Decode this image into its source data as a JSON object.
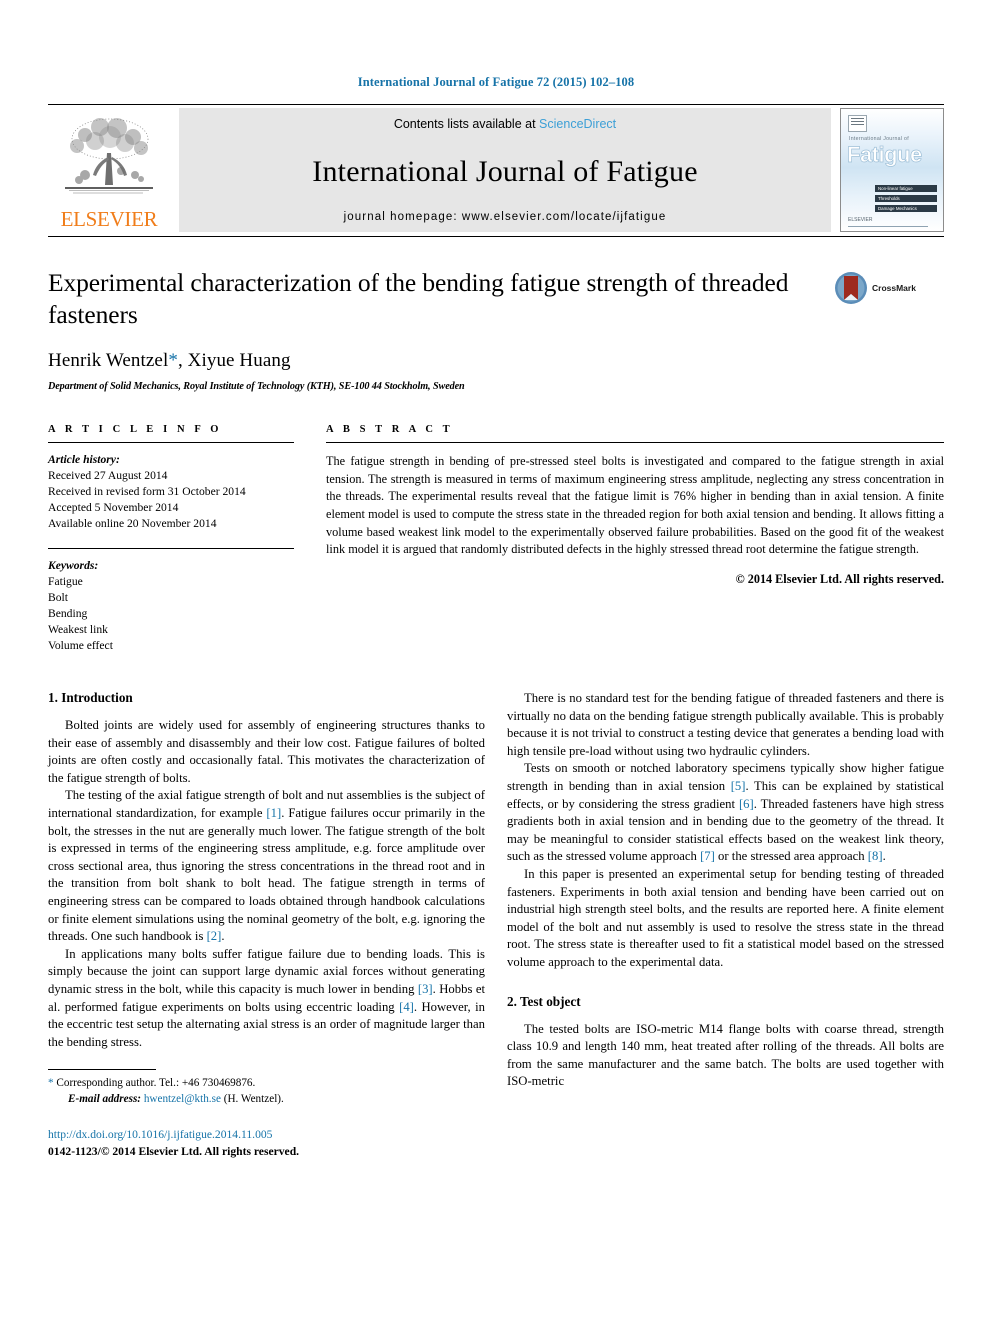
{
  "running_head": "International Journal of Fatigue 72 (2015) 102–108",
  "masthead": {
    "publisher_name": "ELSEVIER",
    "contents_prefix": "Contents lists available at",
    "contents_link": "ScienceDirect",
    "journal_title": "International Journal of Fatigue",
    "homepage": "journal homepage: www.elsevier.com/locate/ijfatigue",
    "cover": {
      "small_title": "International Journal of",
      "big_title": "Fatigue",
      "bars": [
        "Non-linear fatigue",
        "Thresholds",
        "Damage Mechanics"
      ],
      "footer": "ELSEVIER"
    }
  },
  "article": {
    "title": "Experimental characterization of the bending fatigue strength of threaded fasteners",
    "authors": "Henrik Wentzel",
    "author_star": "*",
    "authors_rest": ", Xiyue Huang",
    "affiliation": "Department of Solid Mechanics, Royal Institute of Technology (KTH), SE-100 44 Stockholm, Sweden",
    "crossmark_label": "CrossMark"
  },
  "info": {
    "heading": "A R T I C L E   I N F O",
    "history_label": "Article history:",
    "history": [
      "Received 27 August 2014",
      "Received in revised form 31 October 2014",
      "Accepted 5 November 2014",
      "Available online 20 November 2014"
    ],
    "keywords_label": "Keywords:",
    "keywords": [
      "Fatigue",
      "Bolt",
      "Bending",
      "Weakest link",
      "Volume effect"
    ]
  },
  "abstract": {
    "heading": "A B S T R A C T",
    "text": "The fatigue strength in bending of pre-stressed steel bolts is investigated and compared to the fatigue strength in axial tension. The strength is measured in terms of maximum engineering stress amplitude, neglecting any stress concentration in the threads. The experimental results reveal that the fatigue limit is 76% higher in bending than in axial tension. A finite element model is used to compute the stress state in the threaded region for both axial tension and bending. It allows fitting a volume based weakest link model to the experimentally observed failure probabilities. Based on the good fit of the weakest link model it is argued that randomly distributed defects in the highly stressed thread root determine the fatigue strength.",
    "copyright": "© 2014 Elsevier Ltd. All rights reserved."
  },
  "sections": {
    "intro_heading": "1. Introduction",
    "intro_p1": "Bolted joints are widely used for assembly of engineering structures thanks to their ease of assembly and disassembly and their low cost. Fatigue failures of bolted joints are often costly and occasionally fatal. This motivates the characterization of the fatigue strength of bolts.",
    "intro_p2_a": "The testing of the axial fatigue strength of bolt and nut assemblies is the subject of international standardization, for example ",
    "intro_p2_c1": "[1]",
    "intro_p2_b": ". Fatigue failures occur primarily in the bolt, the stresses in the nut are generally much lower. The fatigue strength of the bolt is expressed in terms of the engineering stress amplitude, e.g. force amplitude over cross sectional area, thus ignoring the stress concentrations in the thread root and in the transition from bolt shank to bolt head. The fatigue strength in terms of engineering stress can be compared to loads obtained through handbook calculations or finite element simulations using the nominal geometry of the bolt, e.g. ignoring the threads. One such handbook is ",
    "intro_p2_c2": "[2]",
    "intro_p2_end": ".",
    "intro_p3_a": "In applications many bolts suffer fatigue failure due to bending loads. This is simply because the joint can support large dynamic axial forces without generating dynamic stress in the bolt, while this capacity is much lower in bending ",
    "intro_p3_c1": "[3]",
    "intro_p3_b": ". Hobbs et al. performed fatigue experiments on bolts using eccentric loading ",
    "intro_p3_c2": "[4]",
    "intro_p3_end": ". However, in the eccentric test setup the alternating axial stress is an order of magnitude larger than the bending stress.",
    "right_p1": "There is no standard test for the bending fatigue of threaded fasteners and there is virtually no data on the bending fatigue strength publically available. This is probably because it is not trivial to construct a testing device that generates a bending load with high tensile pre-load without using two hydraulic cylinders.",
    "right_p2_a": "Tests on smooth or notched laboratory specimens typically show higher fatigue strength in bending than in axial tension ",
    "right_p2_c1": "[5]",
    "right_p2_b": ". This can be explained by statistical effects, or by considering the stress gradient ",
    "right_p2_c2": "[6]",
    "right_p2_c": ". Threaded fasteners have high stress gradients both in axial tension and in bending due to the geometry of the thread. It may be meaningful to consider statistical effects based on the weakest link theory, such as the stressed volume approach ",
    "right_p2_c3": "[7]",
    "right_p2_d": " or the stressed area approach ",
    "right_p2_c4": "[8]",
    "right_p2_end": ".",
    "right_p3": "In this paper is presented an experimental setup for bending testing of threaded fasteners. Experiments in both axial tension and bending have been carried out on industrial high strength steel bolts, and the results are reported here. A finite element model of the bolt and nut assembly is used to resolve the stress state in the thread root. The stress state is thereafter used to fit a statistical model based on the stressed volume approach to the experimental data.",
    "test_heading": "2. Test object",
    "test_p1": "The tested bolts are ISO-metric M14 flange bolts with coarse thread, strength class 10.9 and length 140 mm, heat treated after rolling of the threads. All bolts are from the same manufacturer and the same batch. The bolts are used together with ISO-metric"
  },
  "footnote": {
    "star": "*",
    "corresponding": " Corresponding author. Tel.: +46 730469876.",
    "email_label": "E-mail address:",
    "email": "hwentzel@kth.se",
    "email_suffix": " (H. Wentzel).",
    "doi": "http://dx.doi.org/10.1016/j.ijfatigue.2014.11.005",
    "issn": "0142-1123/© 2014 Elsevier Ltd. All rights reserved."
  },
  "colors": {
    "link_blue": "#1673a8",
    "sciencedirect_blue": "#3c9fd6",
    "elsevier_orange": "#f07d1a"
  }
}
